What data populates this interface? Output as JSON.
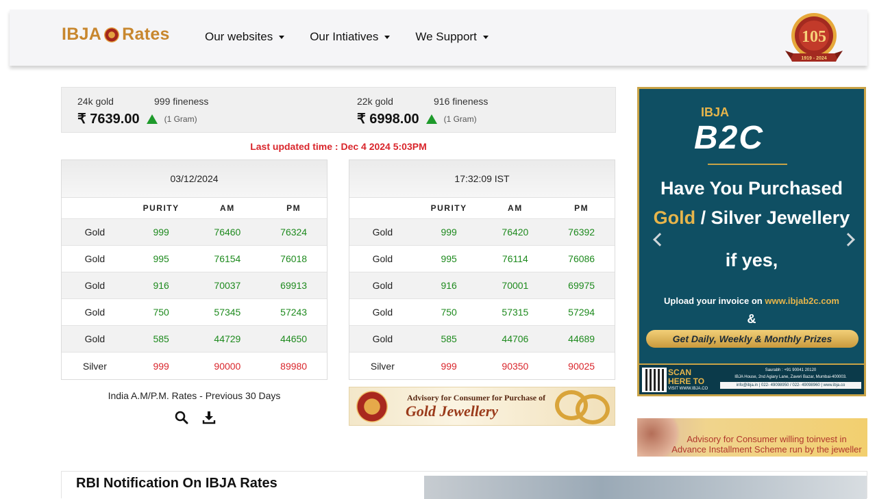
{
  "header": {
    "logo_left": "IBJA",
    "logo_right": "Rates",
    "nav": [
      "Our websites",
      "Our Intiatives",
      "We Support"
    ],
    "badge_number": "105",
    "badge_years": "1919 - 2024"
  },
  "prices": [
    {
      "karat": "24k gold",
      "fineness": "999 fineness",
      "price": "₹ 7639.00",
      "unit": "(1 Gram)",
      "trend": "up"
    },
    {
      "karat": "22k gold",
      "fineness": "916 fineness",
      "price": "₹ 6998.00",
      "unit": "(1 Gram)",
      "trend": "up"
    }
  ],
  "last_updated": "Last updated time : Dec 4 2024 5:03PM",
  "tables": [
    {
      "heading": "03/12/2024",
      "columns": [
        "",
        "PURITY",
        "AM",
        "PM"
      ],
      "rows": [
        [
          "Gold",
          "999",
          "76460",
          "76324"
        ],
        [
          "Gold",
          "995",
          "76154",
          "76018"
        ],
        [
          "Gold",
          "916",
          "70037",
          "69913"
        ],
        [
          "Gold",
          "750",
          "57345",
          "57243"
        ],
        [
          "Gold",
          "585",
          "44729",
          "44650"
        ],
        [
          "Silver",
          "999",
          "90000",
          "89980"
        ]
      ]
    },
    {
      "heading": "17:32:09 IST",
      "columns": [
        "",
        "PURITY",
        "AM",
        "PM"
      ],
      "rows": [
        [
          "Gold",
          "999",
          "76420",
          "76392"
        ],
        [
          "Gold",
          "995",
          "76114",
          "76086"
        ],
        [
          "Gold",
          "916",
          "70001",
          "69975"
        ],
        [
          "Gold",
          "750",
          "57315",
          "57294"
        ],
        [
          "Gold",
          "585",
          "44706",
          "44689"
        ],
        [
          "Silver",
          "999",
          "90350",
          "90025"
        ]
      ]
    }
  ],
  "history": {
    "label": "India A.M/P.M. Rates - Previous 30 Days",
    "icons": [
      "search-icon",
      "download-icon"
    ]
  },
  "advisory_banner": {
    "line1": "Advisory for Consumer for Purchase of",
    "line2": "Gold Jewellery"
  },
  "b2c_ad": {
    "brand_small": "IBJA",
    "brand_big": "B2C",
    "headline_1": "Have You Purchased",
    "headline_2_gold": "Gold",
    "headline_2_rest": " / Silver Jewellery",
    "headline_3": "if yes,",
    "upload_prefix": "Upload your invoice on ",
    "upload_site": "www.ibjab2c.com",
    "amp": "&",
    "prizes": "Get Daily, Weekly & Monthly Prizes",
    "scan": "SCAN",
    "here_to": "HERE TO",
    "visit": "VISIT WWW.IBJA.CO",
    "contact_name": "Saurabh : +91 90041 20120",
    "address": "IBJA House, 2nd Agiary Lane, Zaveri Bazar, Mumbai-400003.",
    "contact_bar": "info@ibja.in | 022- 49098950 / 022- 49098960 | www.ibja.co"
  },
  "install_banner": {
    "line1": "Advisory for Consumer willing toinvest in",
    "line2": "Advance Installment Scheme run by the jeweller"
  },
  "rbi": {
    "title": "RBI Notification On IBJA Rates"
  },
  "colors": {
    "up_green": "#1e9a2b",
    "value_green": "#1e8a1e",
    "silver_red": "#d9252b",
    "brand_gold": "#c8872e"
  }
}
